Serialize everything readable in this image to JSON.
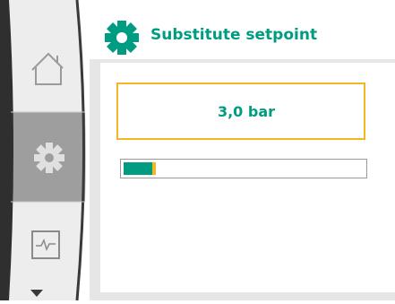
{
  "header": {
    "title": "Substitute setpoint",
    "icon": "gear-icon"
  },
  "setpoint": {
    "value_label": "3,0 bar",
    "level_fraction": 0.12
  },
  "sidebar": {
    "items": [
      {
        "name": "home",
        "icon": "home-icon",
        "selected": false
      },
      {
        "name": "settings",
        "icon": "gear-icon",
        "selected": true
      },
      {
        "name": "monitor",
        "icon": "pulse-icon",
        "selected": false
      }
    ],
    "scroll_icon": "triangle-down-icon"
  },
  "colors": {
    "accent": "#009c82",
    "focus": "#f3b724",
    "sidebar_bg": "#e8e8e8",
    "sidebar_selected": "#9d9d9d",
    "frame": "#3a3a3a"
  }
}
